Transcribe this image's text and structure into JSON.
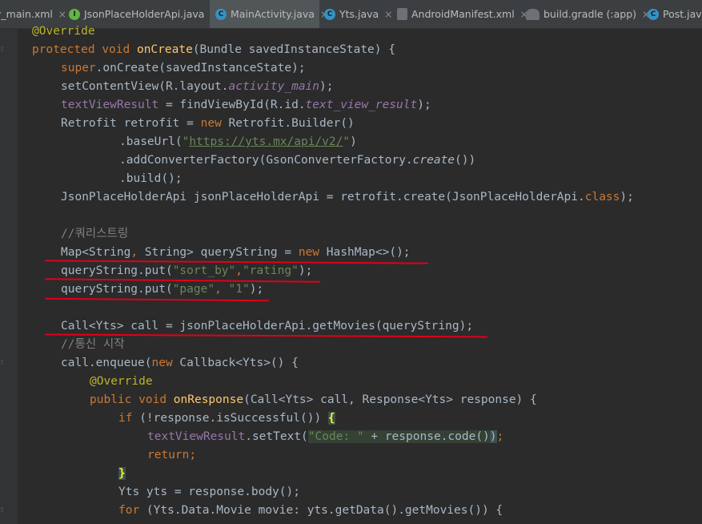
{
  "tabs": [
    {
      "label": "y_main.xml",
      "icon": "xml-file-icon",
      "icon_glyph": "",
      "icon_color": "",
      "close": "×",
      "active": false
    },
    {
      "label": "JsonPlaceHolderApi.java",
      "icon": "interface-icon",
      "icon_glyph": "I",
      "icon_color": "#62b543",
      "close": "×",
      "active": false
    },
    {
      "label": "MainActivity.java",
      "icon": "class-icon",
      "icon_glyph": "C",
      "icon_color": "#3592c4",
      "close": "×",
      "active": true
    },
    {
      "label": "Yts.java",
      "icon": "class-icon",
      "icon_glyph": "C",
      "icon_color": "#3592c4",
      "close": "×",
      "active": false
    },
    {
      "label": "AndroidManifest.xml",
      "icon": "manifest-file-icon",
      "icon_glyph": "",
      "icon_color": "#6e7073",
      "close": "×",
      "active": false
    },
    {
      "label": "build.gradle (:app)",
      "icon": "gradle-icon",
      "icon_glyph": "",
      "icon_color": "#6e7073",
      "close": "×",
      "active": false
    },
    {
      "label": "Post.java",
      "icon": "class-icon",
      "icon_glyph": "C",
      "icon_color": "#3592c4",
      "close": "",
      "active": false
    }
  ],
  "code": {
    "l01": {
      "ann": "@Override"
    },
    "l02": {
      "kw1": "protected",
      "kw2": "void",
      "method": "onCreate",
      "rest": "(Bundle savedInstanceState) {"
    },
    "l03": {
      "kw": "super",
      "rest": ".onCreate(savedInstanceState);"
    },
    "l04": {
      "a": "setContentView(R.layout.",
      "field": "activity_main",
      "b": ");"
    },
    "l05": {
      "field": "textViewResult",
      "a": " = findViewById(R.id.",
      "field2": "text_view_result",
      "b": ");"
    },
    "l06": {
      "a": "Retrofit retrofit = ",
      "kw": "new",
      "b": " Retrofit.Builder()"
    },
    "l07": {
      "a": ".baseUrl(",
      "q1": "\"",
      "url": "https://yts.mx/api/v2/",
      "q2": "\"",
      "b": ")"
    },
    "l08": {
      "a": ".addConverterFactory(GsonConverterFactory.",
      "it": "create",
      "b": "())"
    },
    "l09": {
      "a": ".build();"
    },
    "l10": {
      "a": "JsonPlaceHolderApi jsonPlaceHolderApi = retrofit.create(JsonPlaceHolderApi.",
      "kw": "class",
      "b": ");"
    },
    "l11": {
      "cm": "//쿼리스트링"
    },
    "l12": {
      "a": "Map<String",
      "kw": ",",
      "b": " String> queryString = ",
      "kw2": "new",
      "c": " HashMap<>();"
    },
    "l13": {
      "a": "queryString.put(",
      "s1": "\"sort_by\"",
      "kw": ",",
      "s2": "\"rating\"",
      "b": ");"
    },
    "l14": {
      "a": "queryString.put(",
      "s1": "\"page\"",
      "kw": ",",
      "sp": " ",
      "s2": "\"1\"",
      "b": ");"
    },
    "l15": {
      "a": "Call<Yts> call = jsonPlaceHolderApi.getMovies(queryString);"
    },
    "l16": {
      "cm": "//통신 시작"
    },
    "l17": {
      "a": "call.enqueue(",
      "kw": "new",
      "b": " Callback<Yts>() {"
    },
    "l18": {
      "ann": "@Override"
    },
    "l19": {
      "kw1": "public",
      "kw2": "void",
      "method": "onResponse",
      "rest": "(Call<Yts> call, Response<Yts> response) {"
    },
    "l20": {
      "kw": "if",
      "a": " (!response.isSuccessful()) ",
      "brace": "{"
    },
    "l21": {
      "field": "textViewResult",
      "a": ".setText(",
      "str": "\"Code: \"",
      "b": " + response.code()",
      "c": ")",
      "d": ";"
    },
    "l22": {
      "kw": "return;"
    },
    "l23": {
      "brace": "}"
    },
    "l24": {
      "a": "Yts yts = response.body();"
    },
    "l25": {
      "kw": "for",
      "a": " (Yts.Data.Movie movie: yts.getData().getMovies()) {"
    }
  },
  "gutter": {
    "fold": "▯"
  },
  "colors": {
    "background": "#2b2b2b",
    "keyword": "#cc7832",
    "method": "#ffc66d",
    "field": "#9876aa",
    "string": "#6a8759",
    "annotation": "#bbb529",
    "comment": "#808080",
    "underline": "#e1001a"
  }
}
